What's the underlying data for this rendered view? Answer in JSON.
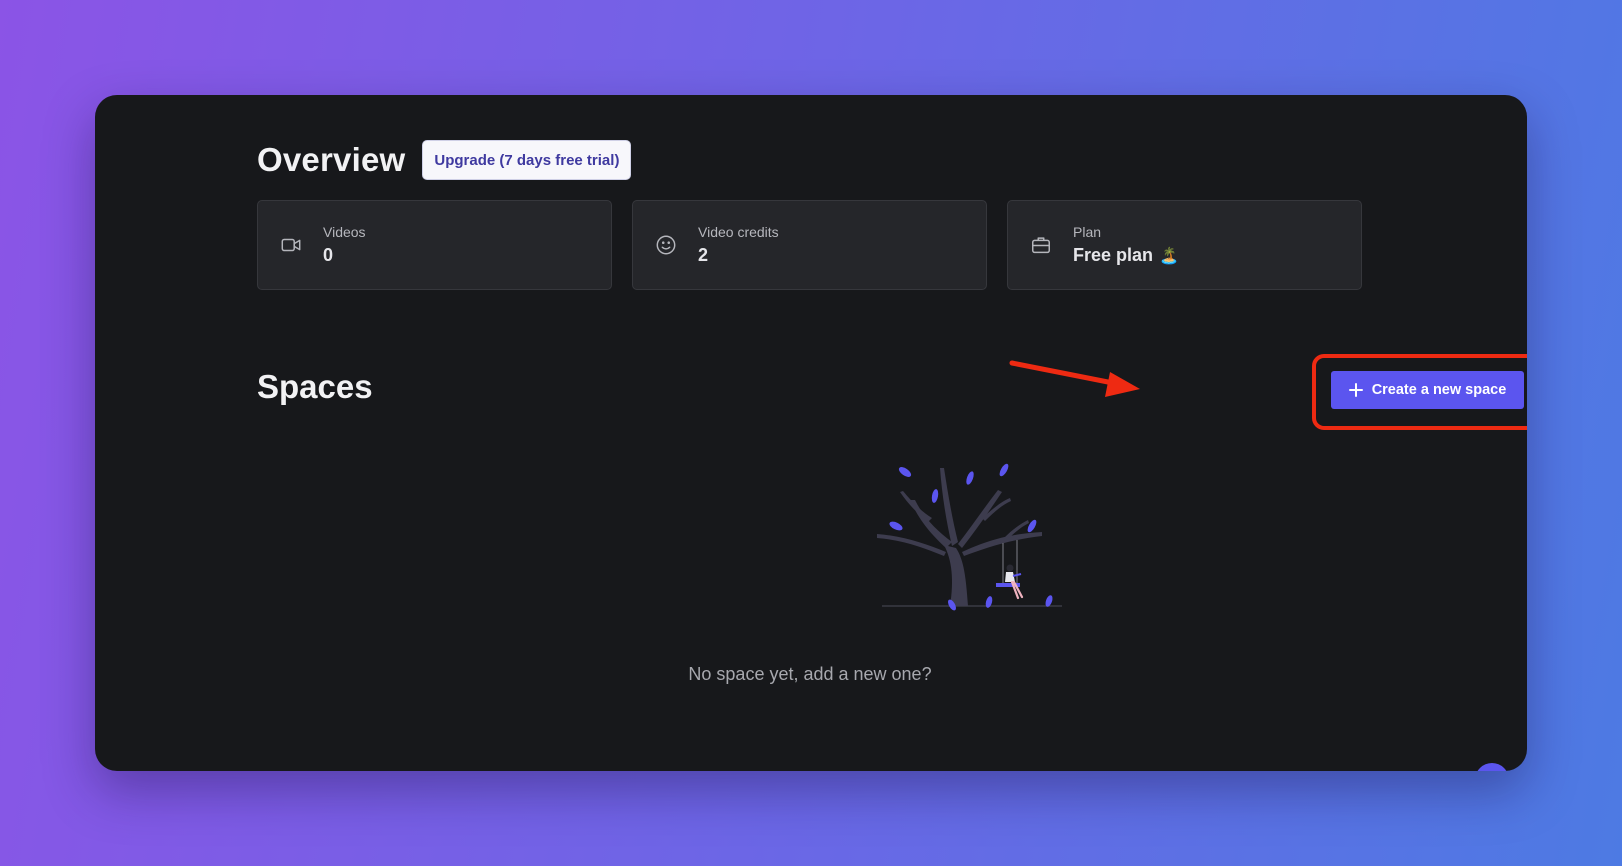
{
  "overview": {
    "title": "Overview",
    "upgrade_label": "Upgrade (7 days free trial)"
  },
  "stats": [
    {
      "icon": "video-camera-icon",
      "label": "Videos",
      "value": "0"
    },
    {
      "icon": "smiley-face-icon",
      "label": "Video credits",
      "value": "2"
    },
    {
      "icon": "briefcase-icon",
      "label": "Plan",
      "value": "Free plan",
      "emoji": "🏝️"
    }
  ],
  "spaces": {
    "title": "Spaces",
    "create_label": "Create a new space",
    "empty_text": "No space yet, add a new one?"
  },
  "colors": {
    "accent": "#5b55ef",
    "annotation": "#ee2a12",
    "window_bg": "#17181b",
    "card_bg": "#25262a"
  }
}
